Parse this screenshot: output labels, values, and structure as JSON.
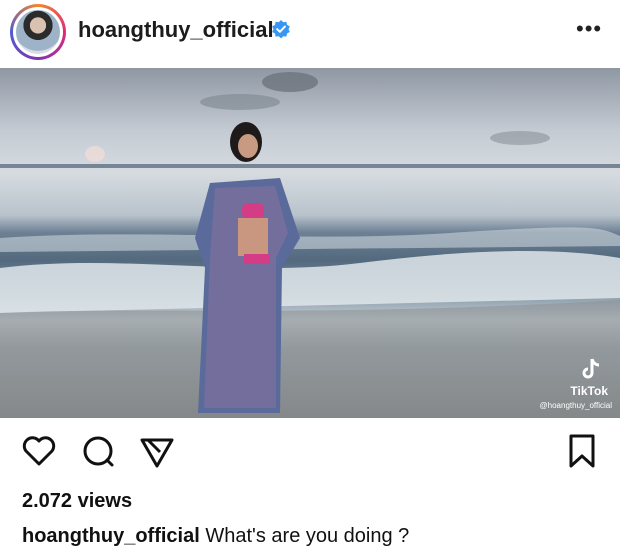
{
  "header": {
    "username": "hoangthuy_official",
    "more_label": "•••",
    "verified_icon": "verified-badge-icon"
  },
  "media": {
    "watermark_label": "TikTok",
    "watermark_handle": "@hoangthuy_official"
  },
  "actions": {
    "icons": [
      "heart-icon",
      "comment-icon",
      "share-icon",
      "bookmark-icon"
    ]
  },
  "stats": {
    "views": "2.072 views"
  },
  "caption": {
    "username": "hoangthuy_official",
    "text": "What's are you doing ?"
  },
  "colors": {
    "verified": "#3897f0",
    "text": "#111111"
  }
}
